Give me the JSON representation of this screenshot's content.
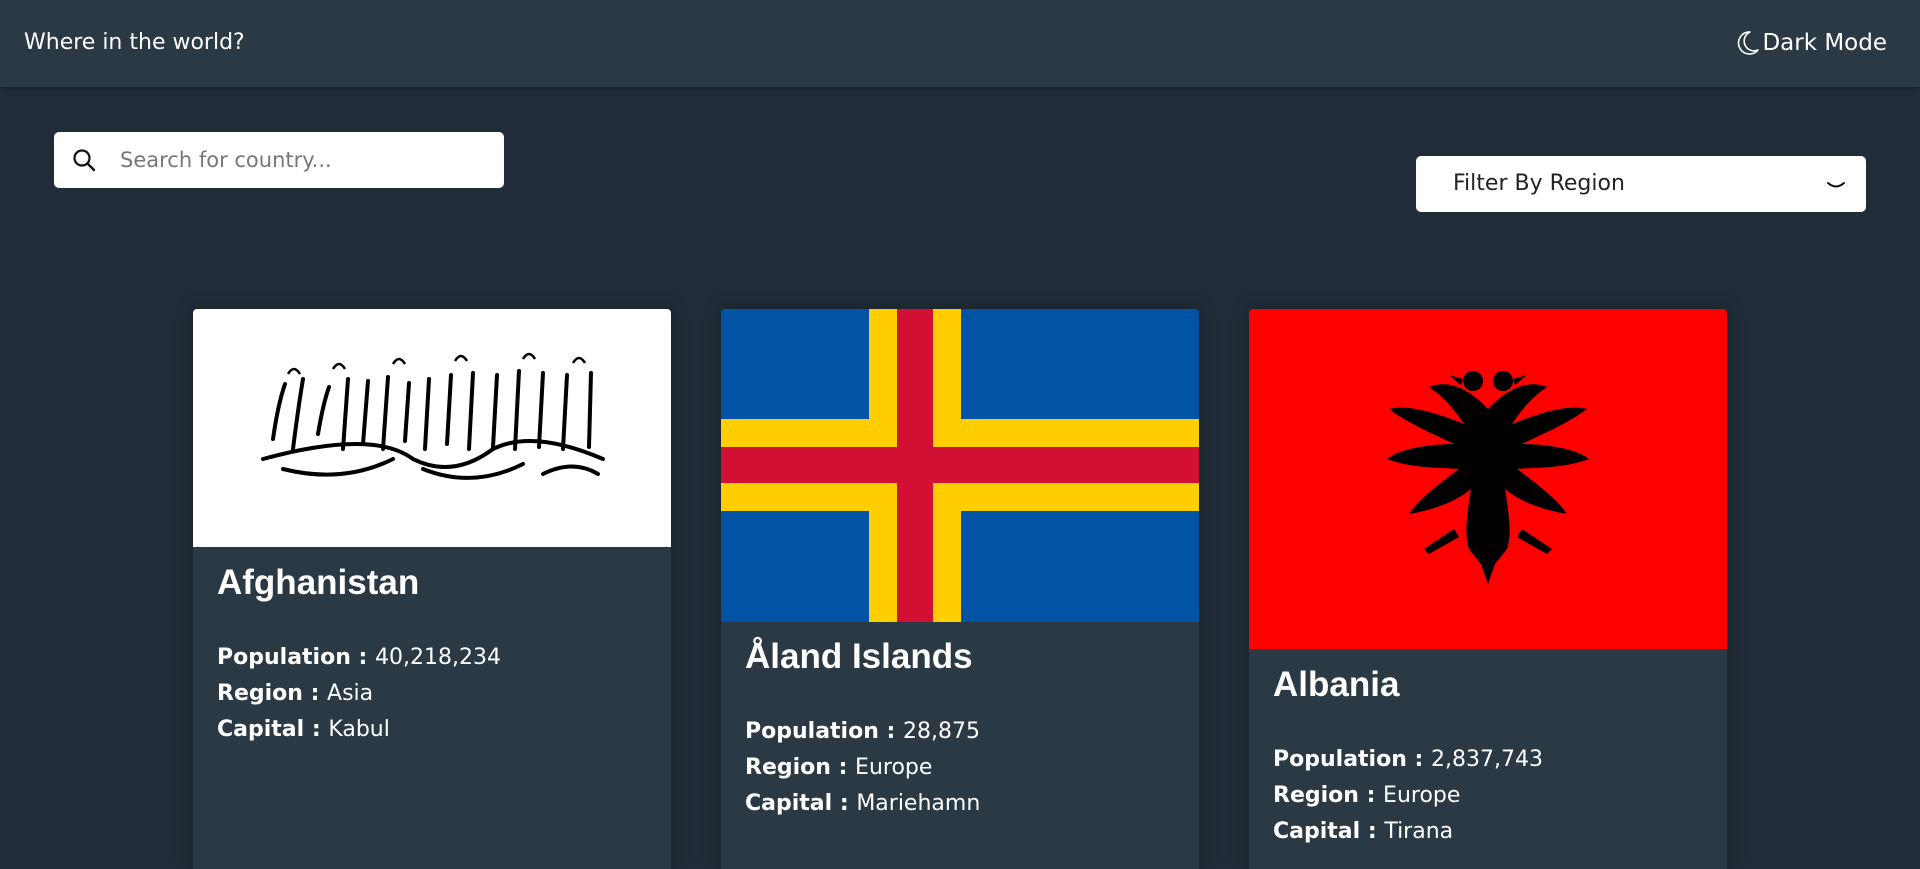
{
  "header": {
    "title": "Where in the world?",
    "theme_label": "Dark Mode",
    "theme_icon": "moon-icon"
  },
  "search": {
    "placeholder": "Search for country...",
    "value": "",
    "icon": "search-icon"
  },
  "filter": {
    "label": "Filter By Region",
    "icon": "chevron-down-icon"
  },
  "labels": {
    "population": "Population : ",
    "region": "Region : ",
    "capital": "Capital : "
  },
  "countries": [
    {
      "name": "Afghanistan",
      "population": "40,218,234",
      "region": "Asia",
      "capital": "Kabul"
    },
    {
      "name": "Åland Islands",
      "population": "28,875",
      "region": "Europe",
      "capital": "Mariehamn"
    },
    {
      "name": "Albania",
      "population": "2,837,743",
      "region": "Europe",
      "capital": "Tirana"
    }
  ],
  "colors": {
    "background": "#202c37",
    "elements": "#2b3945",
    "aland_blue": "#0053a5",
    "aland_yellow": "#ffce00",
    "aland_red": "#d21034",
    "albania_red": "#ff0000"
  }
}
